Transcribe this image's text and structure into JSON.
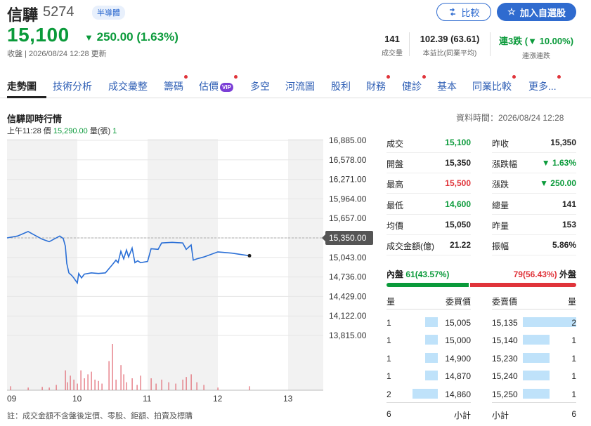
{
  "header": {
    "name": "信驊",
    "code": "5274",
    "industry": "半導體",
    "compare_label": "比較",
    "watch_label": "加入自選股",
    "price": "15,100",
    "change": "250.00 (1.63%)",
    "market_status": "收盤",
    "timestamp": "2026/08/24 12:28 更新",
    "stats": [
      {
        "value": "141",
        "label": "成交量"
      },
      {
        "value": "102.39 (63.61)",
        "label": "本益比(同業平均)"
      },
      {
        "value": "連3跌 (▼ 10.00%)",
        "label": "連漲連跌"
      }
    ]
  },
  "tabs": [
    {
      "label": "走勢圖",
      "dot": false
    },
    {
      "label": "技術分析",
      "dot": false
    },
    {
      "label": "成交彙整",
      "dot": false
    },
    {
      "label": "籌碼",
      "dot": true
    },
    {
      "label": "估價",
      "dot": true,
      "badge": "VIP"
    },
    {
      "label": "多空",
      "dot": false
    },
    {
      "label": "河流圖",
      "dot": false
    },
    {
      "label": "股利",
      "dot": false
    },
    {
      "label": "財務",
      "dot": true
    },
    {
      "label": "健診",
      "dot": true
    },
    {
      "label": "基本",
      "dot": false
    },
    {
      "label": "同業比較",
      "dot": true
    },
    {
      "label": "更多...",
      "dot": true
    }
  ],
  "section": {
    "title": "信驊即時行情",
    "data_time": "資料時間：2026/08/24 12:28",
    "tooltip_time": "上午11:28",
    "tooltip_price_label": "價",
    "tooltip_price": "15,290.00",
    "tooltip_vol_label": "量(張)",
    "tooltip_vol": "1"
  },
  "chart_data": {
    "type": "line",
    "y_ticks": [
      "16,885.00",
      "16,578.00",
      "16,271.00",
      "15,964.00",
      "15,657.00",
      "15,350.00",
      "15,043.00",
      "14,736.00",
      "14,429.00",
      "14,122.00",
      "13,815.00"
    ],
    "ylim": [
      13815,
      16885
    ],
    "reference_price": 15350,
    "reference_label": "15,350.00",
    "x_ticks": [
      "09",
      "10",
      "11",
      "12",
      "13"
    ],
    "xlim": [
      9,
      13.5
    ],
    "price_points": [
      [
        9.0,
        15350
      ],
      [
        9.15,
        15380
      ],
      [
        9.3,
        15450
      ],
      [
        9.4,
        15390
      ],
      [
        9.5,
        15330
      ],
      [
        9.6,
        15290
      ],
      [
        9.75,
        15380
      ],
      [
        9.8,
        15340
      ],
      [
        9.83,
        15220
      ],
      [
        9.85,
        14950
      ],
      [
        9.88,
        14800
      ],
      [
        9.92,
        14760
      ],
      [
        9.95,
        14720
      ],
      [
        10.0,
        14640
      ],
      [
        10.02,
        14790
      ],
      [
        10.06,
        14720
      ],
      [
        10.1,
        14780
      ],
      [
        10.2,
        14800
      ],
      [
        10.3,
        14790
      ],
      [
        10.4,
        14800
      ],
      [
        10.5,
        14930
      ],
      [
        10.55,
        15000
      ],
      [
        10.58,
        14960
      ],
      [
        10.62,
        15140
      ],
      [
        10.66,
        15020
      ],
      [
        10.7,
        15160
      ],
      [
        10.73,
        15050
      ],
      [
        10.78,
        15190
      ],
      [
        10.82,
        14960
      ],
      [
        10.86,
        14990
      ],
      [
        10.9,
        14960
      ],
      [
        11.0,
        14980
      ],
      [
        11.05,
        15180
      ],
      [
        11.15,
        15170
      ],
      [
        11.2,
        15270
      ],
      [
        11.35,
        15280
      ],
      [
        11.5,
        15270
      ],
      [
        11.55,
        15170
      ],
      [
        11.62,
        15240
      ],
      [
        11.65,
        15000
      ],
      [
        11.7,
        15020
      ],
      [
        11.8,
        15050
      ],
      [
        12.0,
        15130
      ],
      [
        12.2,
        15110
      ],
      [
        12.45,
        15070
      ]
    ],
    "volume_points": [
      [
        9.05,
        6
      ],
      [
        9.3,
        4
      ],
      [
        9.5,
        5
      ],
      [
        9.6,
        4
      ],
      [
        9.7,
        8
      ],
      [
        9.83,
        30
      ],
      [
        9.86,
        12
      ],
      [
        9.9,
        22
      ],
      [
        9.95,
        16
      ],
      [
        10.0,
        10
      ],
      [
        10.05,
        30
      ],
      [
        10.1,
        18
      ],
      [
        10.15,
        24
      ],
      [
        10.2,
        28
      ],
      [
        10.25,
        16
      ],
      [
        10.3,
        14
      ],
      [
        10.35,
        10
      ],
      [
        10.45,
        44
      ],
      [
        10.5,
        70
      ],
      [
        10.55,
        16
      ],
      [
        10.62,
        38
      ],
      [
        10.66,
        24
      ],
      [
        10.7,
        12
      ],
      [
        10.78,
        18
      ],
      [
        10.85,
        8
      ],
      [
        10.9,
        22
      ],
      [
        11.05,
        18
      ],
      [
        11.12,
        10
      ],
      [
        11.2,
        16
      ],
      [
        11.3,
        12
      ],
      [
        11.4,
        10
      ],
      [
        11.5,
        16
      ],
      [
        11.55,
        20
      ],
      [
        11.62,
        24
      ],
      [
        11.7,
        12
      ],
      [
        11.8,
        8
      ],
      [
        12.0,
        4
      ],
      [
        12.45,
        6
      ]
    ],
    "line_color": "#2a6fd6",
    "volume_color": "#e06670",
    "grid": true
  },
  "quote": {
    "left": [
      {
        "label": "成交",
        "value": "15,100",
        "color": "green"
      },
      {
        "label": "開盤",
        "value": "15,350",
        "color": "default"
      },
      {
        "label": "最高",
        "value": "15,500",
        "color": "red"
      },
      {
        "label": "最低",
        "value": "14,600",
        "color": "green"
      },
      {
        "label": "均價",
        "value": "15,050",
        "color": "default"
      },
      {
        "label": "成交金額(億)",
        "value": "21.22",
        "color": "default"
      }
    ],
    "right": [
      {
        "label": "昨收",
        "value": "15,350",
        "color": "default"
      },
      {
        "label": "漲跌幅",
        "value": "▼ 1.63%",
        "color": "green"
      },
      {
        "label": "漲跌",
        "value": "▼ 250.00",
        "color": "green"
      },
      {
        "label": "總量",
        "value": "141",
        "color": "default"
      },
      {
        "label": "昨量",
        "value": "153",
        "color": "default"
      },
      {
        "label": "振幅",
        "value": "5.86%",
        "color": "default"
      }
    ]
  },
  "orderbook": {
    "inner_label": "內盤",
    "inner_value": "61(43.57%)",
    "inner_fraction": 0.4357,
    "outer_value": "79(56.43%)",
    "outer_label": "外盤",
    "headers": [
      "量",
      "委買價",
      "委賣價",
      "量"
    ],
    "bids": [
      {
        "qty": "1",
        "price": "15,005",
        "fraction": 0.5
      },
      {
        "qty": "1",
        "price": "15,000",
        "fraction": 0.5
      },
      {
        "qty": "1",
        "price": "14,900",
        "fraction": 0.5
      },
      {
        "qty": "1",
        "price": "14,870",
        "fraction": 0.5
      },
      {
        "qty": "2",
        "price": "14,860",
        "fraction": 1.0
      }
    ],
    "asks": [
      {
        "price": "15,135",
        "qty": "2",
        "fraction": 1.0
      },
      {
        "price": "15,140",
        "qty": "1",
        "fraction": 0.5
      },
      {
        "price": "15,230",
        "qty": "1",
        "fraction": 0.5
      },
      {
        "price": "15,240",
        "qty": "1",
        "fraction": 0.5
      },
      {
        "price": "15,250",
        "qty": "1",
        "fraction": 0.5
      }
    ],
    "bid_total": "6",
    "bid_subtotal_label": "小計",
    "ask_subtotal_label": "小計",
    "ask_total": "6"
  },
  "footnote": "註：成交金額不含盤後定價、零股、鉅額、拍賣及標購"
}
